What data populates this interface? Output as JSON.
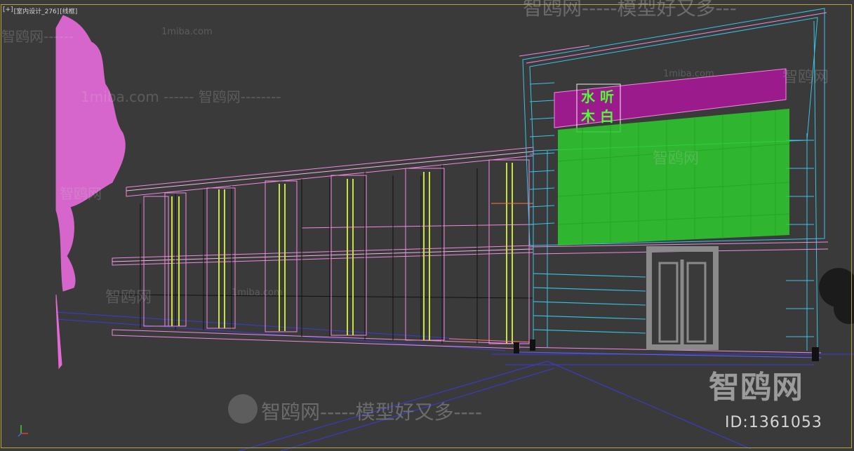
{
  "viewport": {
    "menu_plus": "[+]",
    "view_name": "[室内设计_276]",
    "shading_mode": "[线框]"
  },
  "sign": {
    "line1": "水 听",
    "line2": "木 白"
  },
  "watermarks": {
    "brand": "智鸥网",
    "slogan": "智鸥网-----模型好又多----",
    "header_slogan": "智鸥网-----模型好又多---",
    "dash_brand": "智鸥网------",
    "site_dashes": "1miba.com ------ 智鸥网--------",
    "site": "1miba.com",
    "id": "ID:1361053"
  },
  "colors": {
    "viewport_bg": "#3a3a3a",
    "frame": "#b8a235",
    "tree": "#e46ad8",
    "wire_pink": "#f08ae0",
    "wire_cyan": "#35c6e8",
    "wire_green": "#38e838",
    "wire_yellow": "#c8e040",
    "sign_bg": "#9b1a8c",
    "sign_text": "#4cff30"
  }
}
